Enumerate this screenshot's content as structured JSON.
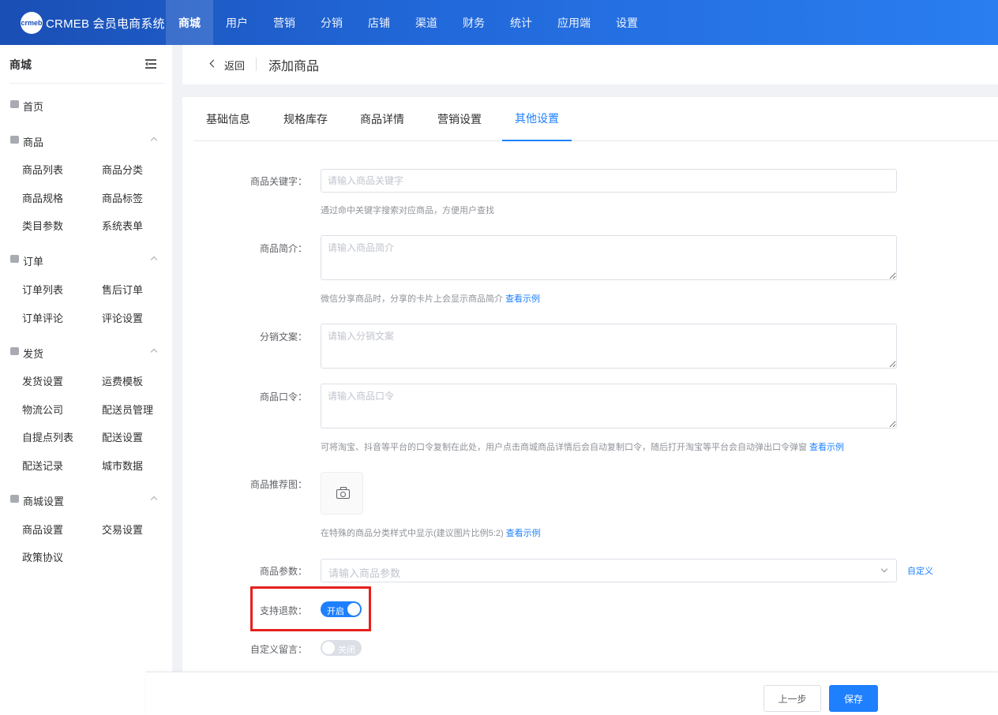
{
  "brand": {
    "badge": "crmeb",
    "name": "CRMEB 会员电商系统"
  },
  "topnav": [
    "商城",
    "用户",
    "营销",
    "分销",
    "店铺",
    "渠道",
    "财务",
    "统计",
    "应用端",
    "设置"
  ],
  "sidebar": {
    "title": "商城",
    "home": "首页",
    "groups": [
      {
        "label": "商品",
        "items": [
          "商品列表",
          "商品分类",
          "商品规格",
          "商品标签",
          "类目参数",
          "系统表单"
        ]
      },
      {
        "label": "订单",
        "items": [
          "订单列表",
          "售后订单",
          "订单评论",
          "评论设置"
        ]
      },
      {
        "label": "发货",
        "items": [
          "发货设置",
          "运费模板",
          "物流公司",
          "配送员管理",
          "自提点列表",
          "配送设置",
          "配送记录",
          "城市数据"
        ]
      },
      {
        "label": "商城设置",
        "items": [
          "商品设置",
          "交易设置",
          "政策协议"
        ]
      }
    ]
  },
  "header": {
    "back": "返回",
    "title": "添加商品"
  },
  "tabs": [
    "基础信息",
    "规格库存",
    "商品详情",
    "营销设置",
    "其他设置"
  ],
  "form": {
    "keyword": {
      "label": "商品关键字：",
      "placeholder": "请输入商品关键字",
      "hint": "通过命中关键字搜索对应商品，方便用户查找"
    },
    "intro": {
      "label": "商品简介：",
      "placeholder": "请输入商品简介",
      "hint": "微信分享商品时，分享的卡片上会显示商品简介",
      "link": "查看示例"
    },
    "copy": {
      "label": "分销文案：",
      "placeholder": "请输入分销文案"
    },
    "command": {
      "label": "商品口令：",
      "placeholder": "请输入商品口令",
      "hint": "可将淘宝、抖音等平台的口令复制在此处，用户点击商城商品详情后会自动复制口令，随后打开淘宝等平台会自动弹出口令弹窗",
      "link": "查看示例"
    },
    "recommend": {
      "label": "商品推荐图：",
      "hint": "在特殊的商品分类样式中显示(建议图片比例5:2)",
      "link": "查看示例"
    },
    "params": {
      "label": "商品参数：",
      "placeholder": "请输入商品参数",
      "custom": "自定义"
    },
    "refund": {
      "label": "支持退款：",
      "state": "开启"
    },
    "message": {
      "label": "自定义留言：",
      "state": "关闭"
    }
  },
  "footer": {
    "prev": "上一步",
    "save": "保存"
  }
}
